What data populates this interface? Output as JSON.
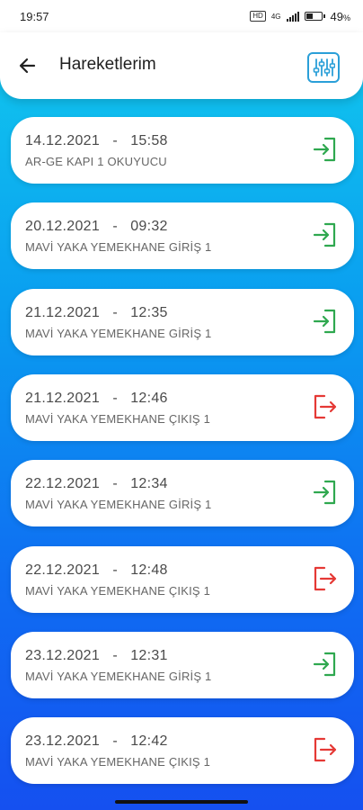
{
  "status_bar": {
    "time": "19:57",
    "network": "4G",
    "battery": "49"
  },
  "header": {
    "title": "Hareketlerim"
  },
  "colors": {
    "entry": "#2fa84f",
    "exit": "#e53935",
    "accent": "#2a9fd8"
  },
  "records": [
    {
      "date": "14.12.2021",
      "time": "15:58",
      "location": "AR-GE KAPI 1 OKUYUCU",
      "type": "entry"
    },
    {
      "date": "20.12.2021",
      "time": "09:32",
      "location": "MAVİ YAKA YEMEKHANE GİRİŞ 1",
      "type": "entry"
    },
    {
      "date": "21.12.2021",
      "time": "12:35",
      "location": "MAVİ YAKA YEMEKHANE GİRİŞ 1",
      "type": "entry"
    },
    {
      "date": "21.12.2021",
      "time": "12:46",
      "location": "MAVİ YAKA YEMEKHANE ÇIKIŞ 1",
      "type": "exit"
    },
    {
      "date": "22.12.2021",
      "time": "12:34",
      "location": "MAVİ YAKA YEMEKHANE GİRİŞ 1",
      "type": "entry"
    },
    {
      "date": "22.12.2021",
      "time": "12:48",
      "location": "MAVİ YAKA YEMEKHANE ÇIKIŞ 1",
      "type": "exit"
    },
    {
      "date": "23.12.2021",
      "time": "12:31",
      "location": "MAVİ YAKA YEMEKHANE GİRİŞ 1",
      "type": "entry"
    },
    {
      "date": "23.12.2021",
      "time": "12:42",
      "location": "MAVİ YAKA YEMEKHANE ÇIKIŞ 1",
      "type": "exit"
    }
  ]
}
